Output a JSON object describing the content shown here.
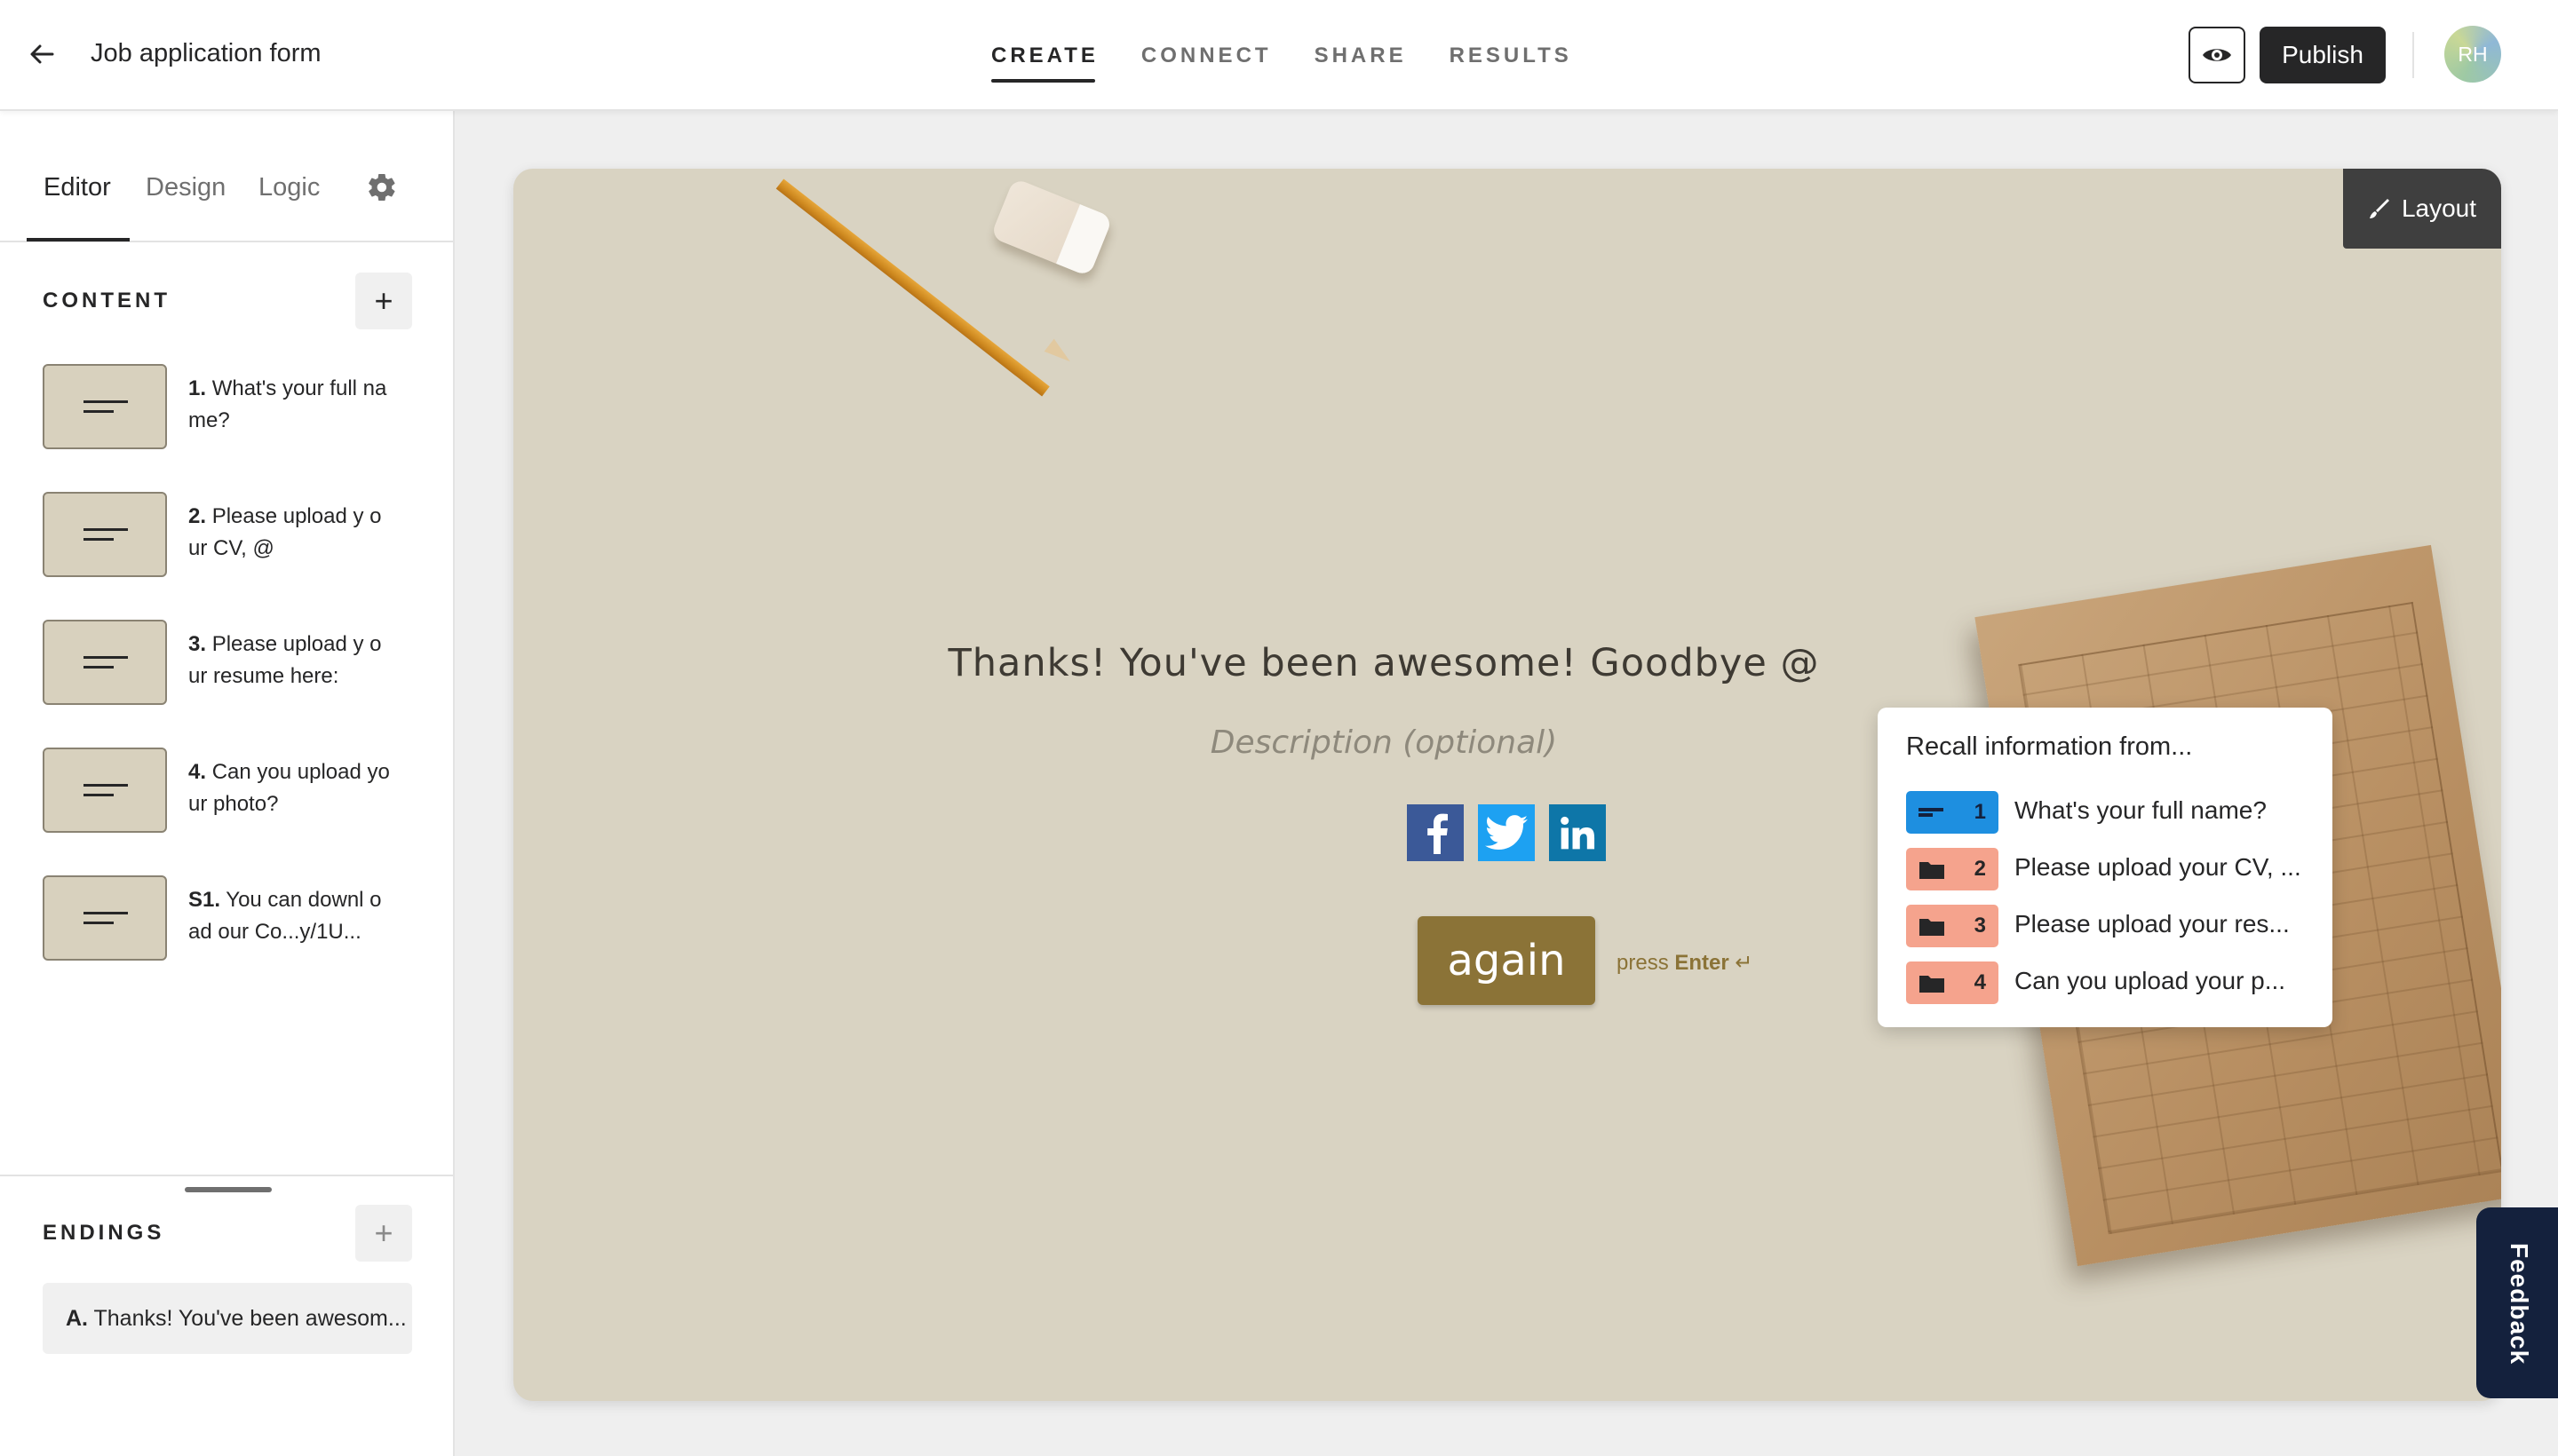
{
  "header": {
    "back_icon": "arrow-left-icon",
    "form_title": "Job application form",
    "tabs": [
      "CREATE",
      "CONNECT",
      "SHARE",
      "RESULTS"
    ],
    "active_tab": "CREATE",
    "preview_icon": "eye-icon",
    "publish_label": "Publish",
    "avatar_initials": "RH"
  },
  "sidebar": {
    "tabs": [
      "Editor",
      "Design",
      "Logic"
    ],
    "active_tab": "Editor",
    "settings_icon": "gear-icon",
    "content_label": "CONTENT",
    "add_content_label": "+",
    "questions": [
      {
        "num": "1.",
        "text": "What's your full name?"
      },
      {
        "num": "2.",
        "text": "Please upload y our CV, @"
      },
      {
        "num": "3.",
        "text": "Please upload y our resume here:"
      },
      {
        "num": "4.",
        "text": "Can you upload your photo?"
      },
      {
        "num": "S1.",
        "text": "You can downl oad our Co...y/1U..."
      }
    ],
    "endings_label": "ENDINGS",
    "add_ending_label": "+",
    "ending": {
      "num": "A.",
      "text": "Thanks! You've been awesom..."
    }
  },
  "canvas": {
    "layout_label": "Layout",
    "layout_icon": "brush-icon",
    "title": "Thanks! You've been awesome! Goodbye @",
    "description_placeholder": "Description (optional)",
    "social": [
      {
        "name": "facebook-icon",
        "glyph": "f",
        "color": "#3b5998"
      },
      {
        "name": "twitter-icon",
        "glyph": "t",
        "color": "#1da1f2"
      },
      {
        "name": "linkedin-icon",
        "glyph": "in",
        "color": "#0e76a8"
      }
    ],
    "again_label": "again",
    "press_prefix": "press",
    "press_key": "Enter",
    "press_symbol": "↵",
    "brand_color": "#8b7337"
  },
  "recall": {
    "title": "Recall information from...",
    "items": [
      {
        "num": "1",
        "text": "What's your full name?",
        "icon": "short-text-icon",
        "color": "blue"
      },
      {
        "num": "2",
        "text": "Please upload your CV, ...",
        "icon": "folder-icon",
        "color": "salmon"
      },
      {
        "num": "3",
        "text": "Please upload your res...",
        "icon": "folder-icon",
        "color": "salmon"
      },
      {
        "num": "4",
        "text": "Can you upload your p...",
        "icon": "folder-icon",
        "color": "salmon"
      }
    ]
  },
  "feedback_label": "Feedback"
}
